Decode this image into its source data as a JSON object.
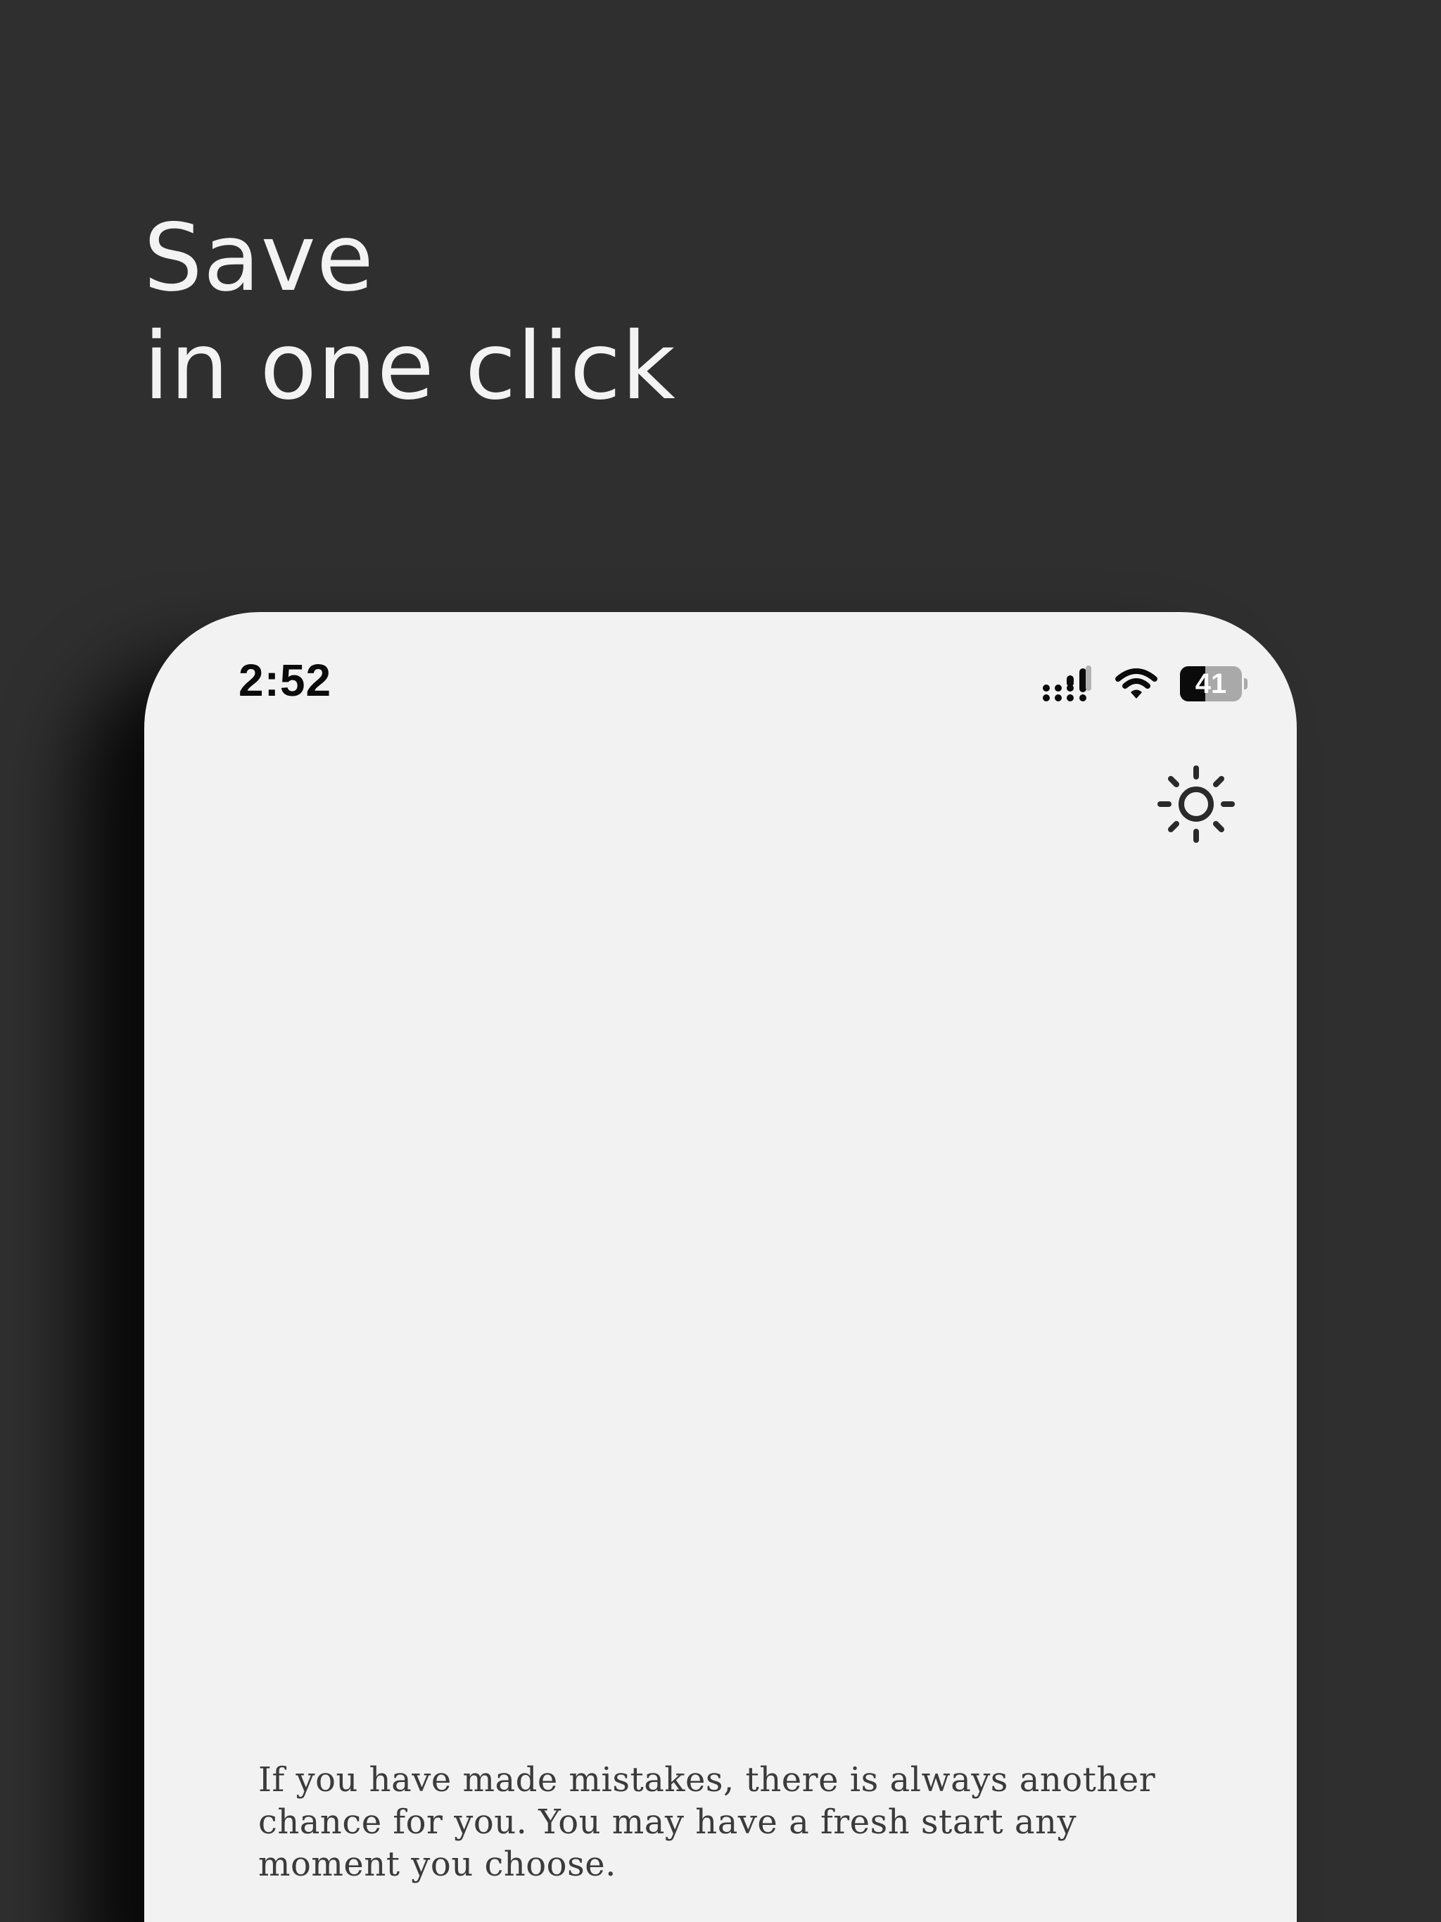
{
  "headline": {
    "line1": "Save",
    "line2": "in one click"
  },
  "status_bar": {
    "time": "2:52",
    "battery_level": "41",
    "battery_fraction": 0.41,
    "icons": [
      "cellular-signal-icon",
      "wifi-icon",
      "battery-icon"
    ]
  },
  "toolbar": {
    "theme_toggle_icon": "sun-icon"
  },
  "quote": {
    "text": "If you have made mistakes, there is always another chance for you. You may have a fresh start any moment you choose."
  },
  "colors": {
    "background": "#2f2f2f",
    "headline_text": "#f3f3f3",
    "screen_background": "#f2f2f2",
    "quote_text": "#3b3b3b",
    "status_text": "#0b0b0b"
  }
}
